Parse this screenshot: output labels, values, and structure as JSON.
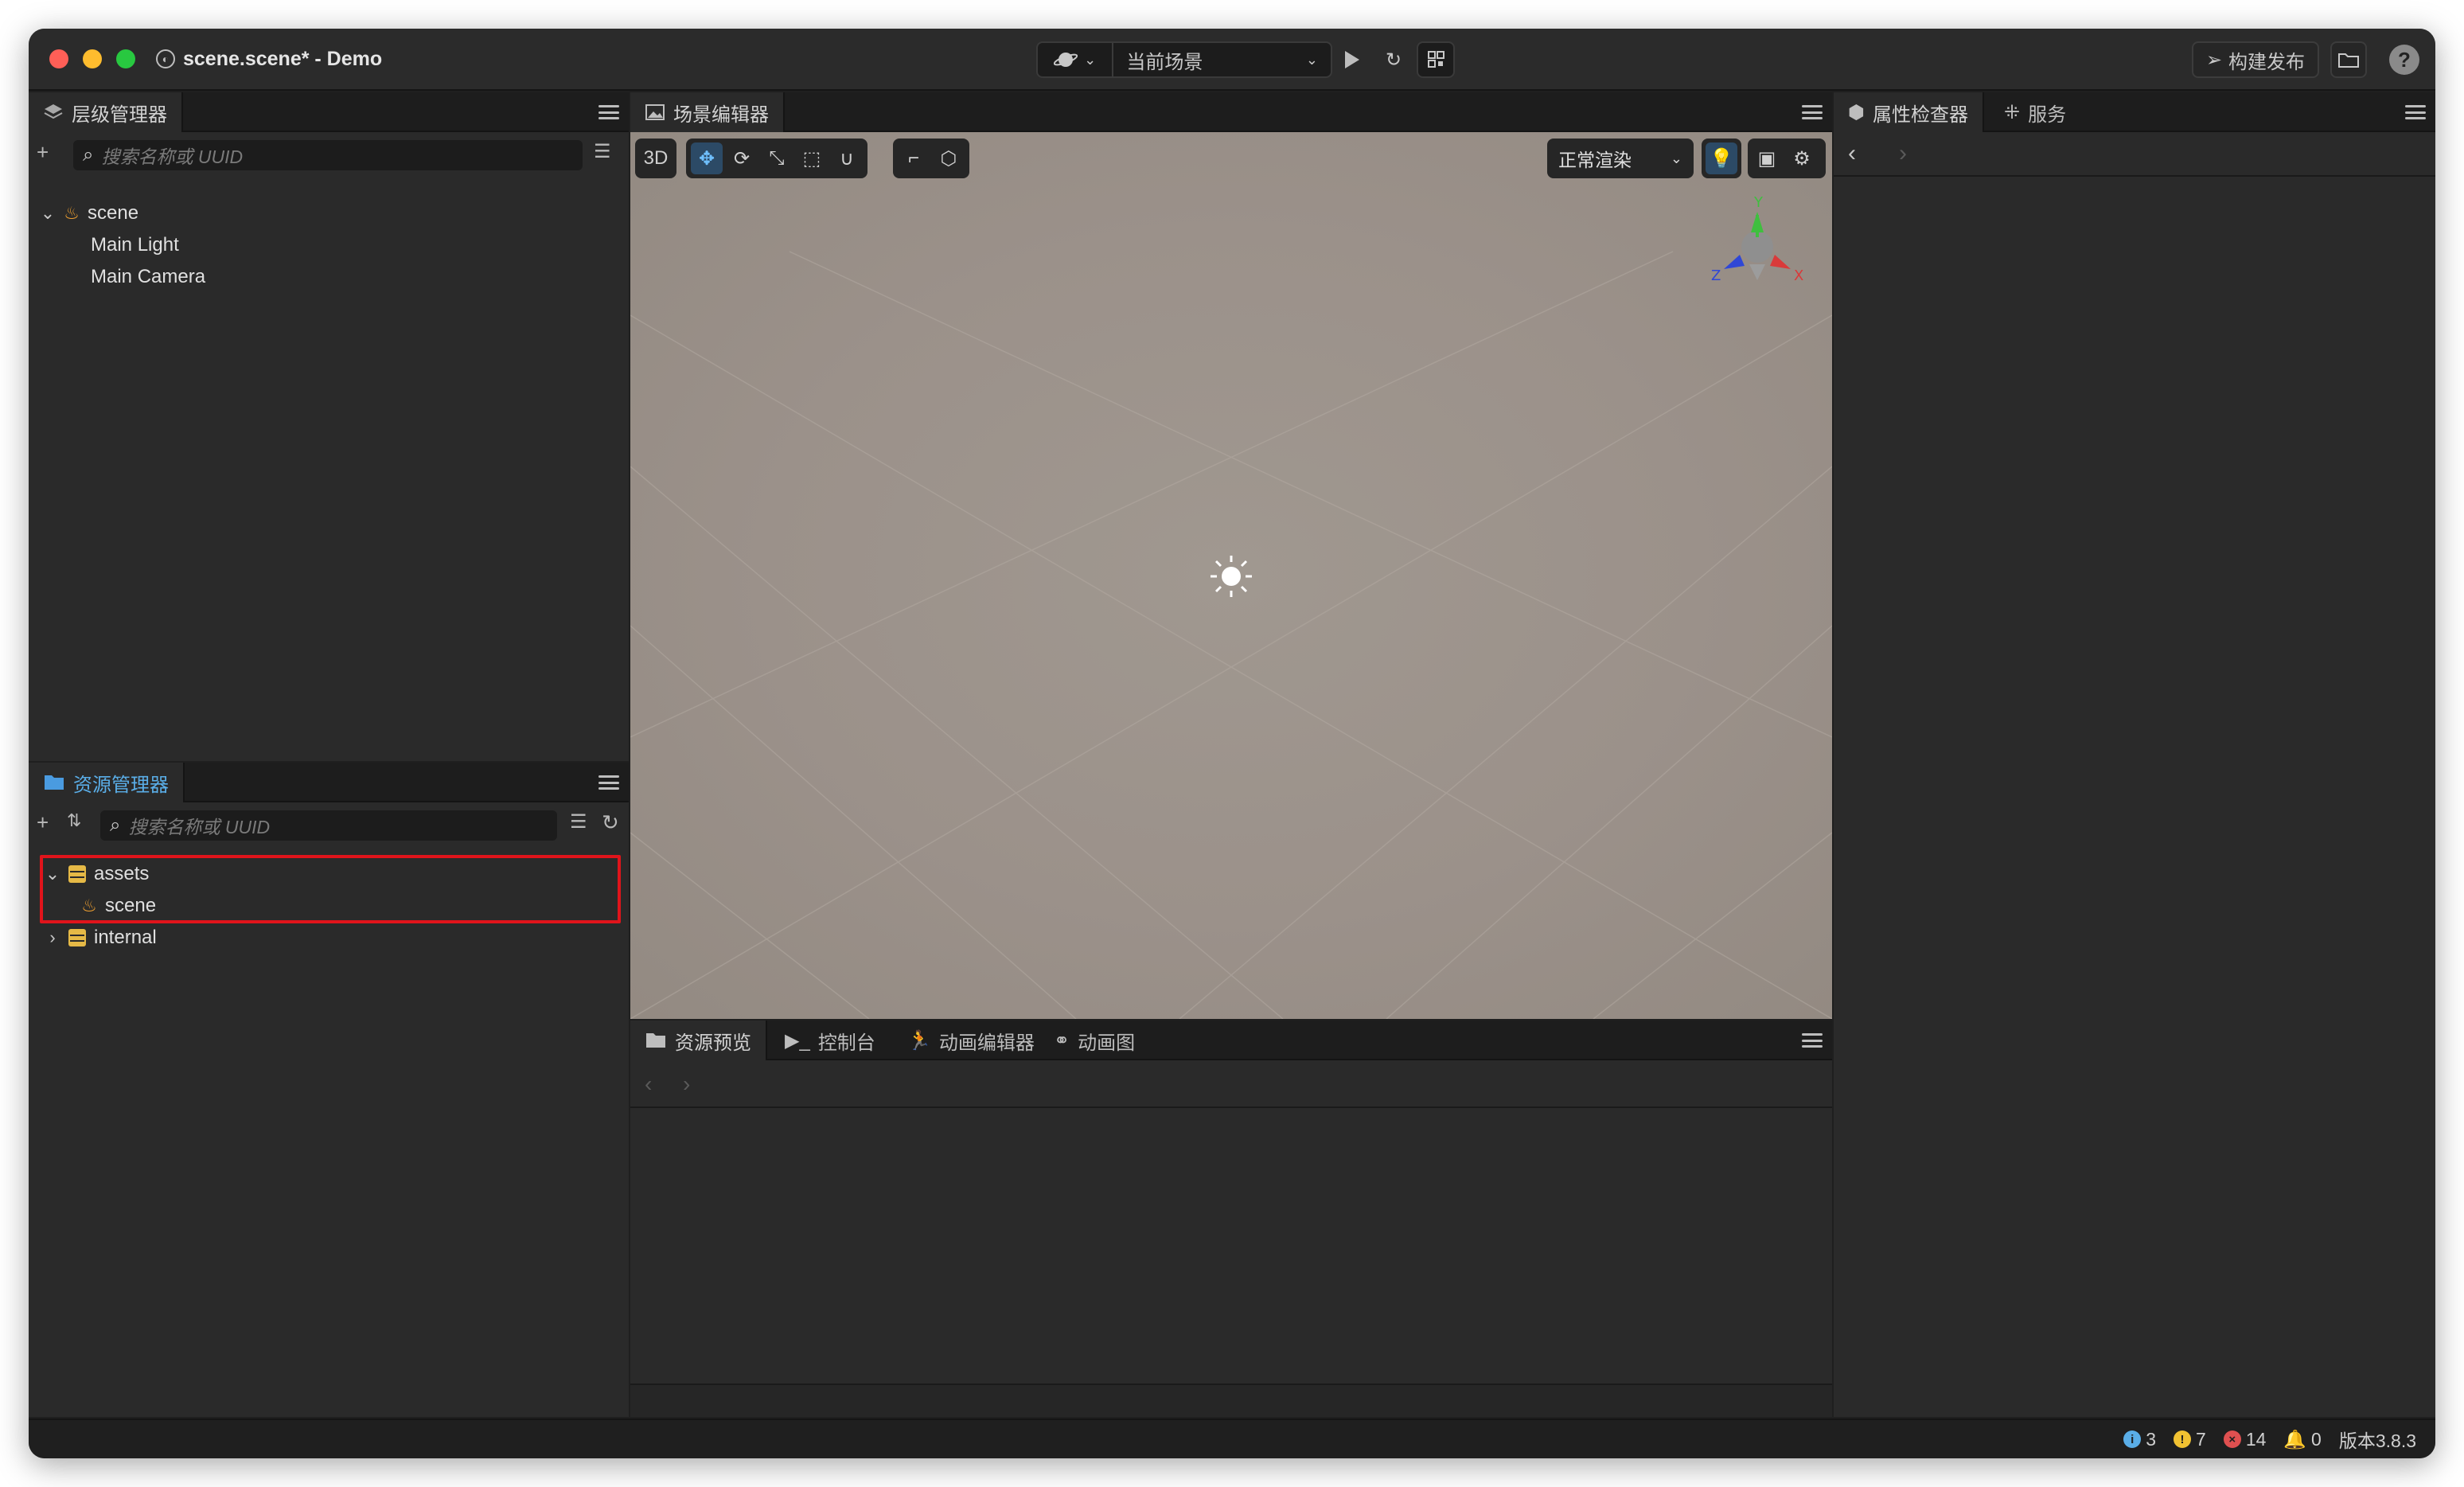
{
  "window": {
    "title": "scene.scene* - Demo"
  },
  "toolbar": {
    "scene_select": "当前场景",
    "build_label": "构建发布",
    "help_label": "?"
  },
  "hierarchy": {
    "tab_label": "层级管理器",
    "search_placeholder": "搜索名称或 UUID",
    "nodes": [
      {
        "label": "scene",
        "kind": "scene",
        "expanded": true
      },
      {
        "label": "Main Light",
        "kind": "node"
      },
      {
        "label": "Main Camera",
        "kind": "node"
      }
    ]
  },
  "assets": {
    "tab_label": "资源管理器",
    "search_placeholder": "搜索名称或 UUID",
    "items": [
      {
        "label": "assets",
        "kind": "folder-db",
        "expanded": true
      },
      {
        "label": "scene",
        "kind": "scene"
      },
      {
        "label": "internal",
        "kind": "folder-db",
        "expanded": false
      }
    ],
    "highlight_color": "#e0141b"
  },
  "scene_editor": {
    "tab_label": "场景编辑器",
    "mode_label": "3D",
    "render_mode": "正常渲染",
    "gizmo": {
      "y": "Y",
      "x": "X",
      "z": "Z"
    }
  },
  "bottom_panel": {
    "tabs": [
      {
        "label": "资源预览"
      },
      {
        "label": "控制台"
      },
      {
        "label": "动画编辑器"
      },
      {
        "label": "动画图"
      }
    ]
  },
  "inspector": {
    "tabs": [
      {
        "label": "属性检查器"
      },
      {
        "label": "服务"
      }
    ]
  },
  "status": {
    "info_count": "3",
    "warning_count": "7",
    "error_count": "14",
    "notification_count": "0",
    "version": "版本3.8.3"
  },
  "colors": {
    "accent": "#5aaee8",
    "panel_bg": "#2a2a2a",
    "viewport_bg": "#9b918a",
    "info": "#5aaee8",
    "warning": "#f1c232",
    "error": "#e05050"
  }
}
